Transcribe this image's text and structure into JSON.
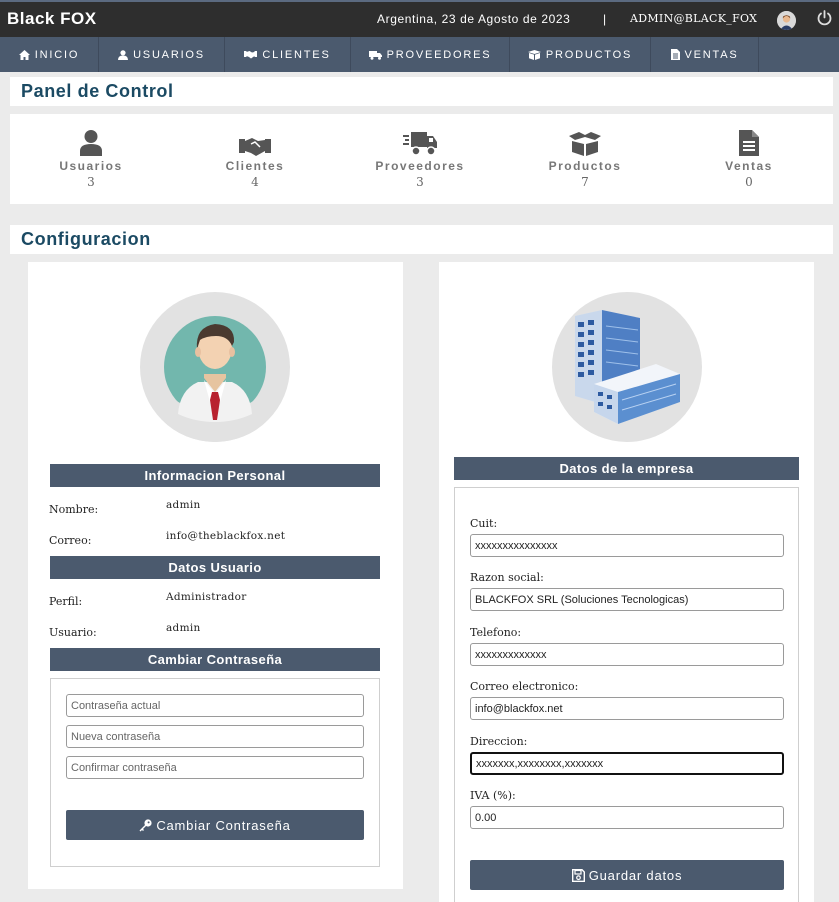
{
  "header": {
    "brand": "Black FOX",
    "date": "Argentina, 23 de Agosto de 2023",
    "separator": "|",
    "user": "ADMIN@BLACK_FOX"
  },
  "nav": {
    "items": [
      {
        "label": "INICIO",
        "icon": "home-icon"
      },
      {
        "label": "USUARIOS",
        "icon": "user-icon"
      },
      {
        "label": "CLIENTES",
        "icon": "handshake-icon"
      },
      {
        "label": "PROVEEDORES",
        "icon": "truck-icon"
      },
      {
        "label": "PRODUCTOS",
        "icon": "box-icon"
      },
      {
        "label": "VENTAS",
        "icon": "file-icon"
      }
    ]
  },
  "panel": {
    "title": "Panel de Control",
    "stats": [
      {
        "label": "Usuarios",
        "value": "3",
        "icon": "user-icon"
      },
      {
        "label": "Clientes",
        "value": "4",
        "icon": "handshake-icon"
      },
      {
        "label": "Proveedores",
        "value": "3",
        "icon": "truck-icon"
      },
      {
        "label": "Productos",
        "value": "7",
        "icon": "box-icon"
      },
      {
        "label": "Ventas",
        "value": "0",
        "icon": "file-icon"
      }
    ]
  },
  "config": {
    "title": "Configuracion",
    "personal": {
      "title": "Informacion Personal",
      "name_label": "Nombre:",
      "name_value": "admin",
      "email_label": "Correo:",
      "email_value": "info@theblackfox.net"
    },
    "user_data": {
      "title": "Datos Usuario",
      "profile_label": "Perfil:",
      "profile_value": "Administrador",
      "user_label": "Usuario:",
      "user_value": "admin"
    },
    "password": {
      "title": "Cambiar Contraseña",
      "current_placeholder": "Contraseña actual",
      "new_placeholder": "Nueva contraseña",
      "confirm_placeholder": "Confirmar contraseña",
      "button": "Cambiar Contraseña"
    },
    "company": {
      "title": "Datos de la empresa",
      "cuit_label": "Cuit:",
      "cuit_value": "xxxxxxxxxxxxxxx",
      "razon_label": "Razon social:",
      "razon_value": "BLACKFOX SRL (Soluciones Tecnologicas)",
      "phone_label": "Telefono:",
      "phone_value": "xxxxxxxxxxxxx",
      "email_label": "Correo electronico:",
      "email_value": "info@blackfox.net",
      "address_label": "Direccion:",
      "address_value": "xxxxxxx,xxxxxxxx,xxxxxxx",
      "iva_label": "IVA (%):",
      "iva_value": "0.00",
      "button": "Guardar datos"
    }
  },
  "colors": {
    "topbar": "#2e2e2e",
    "nav": "#4b5a6e",
    "title": "#1b4a63",
    "background": "#ebebeb"
  }
}
